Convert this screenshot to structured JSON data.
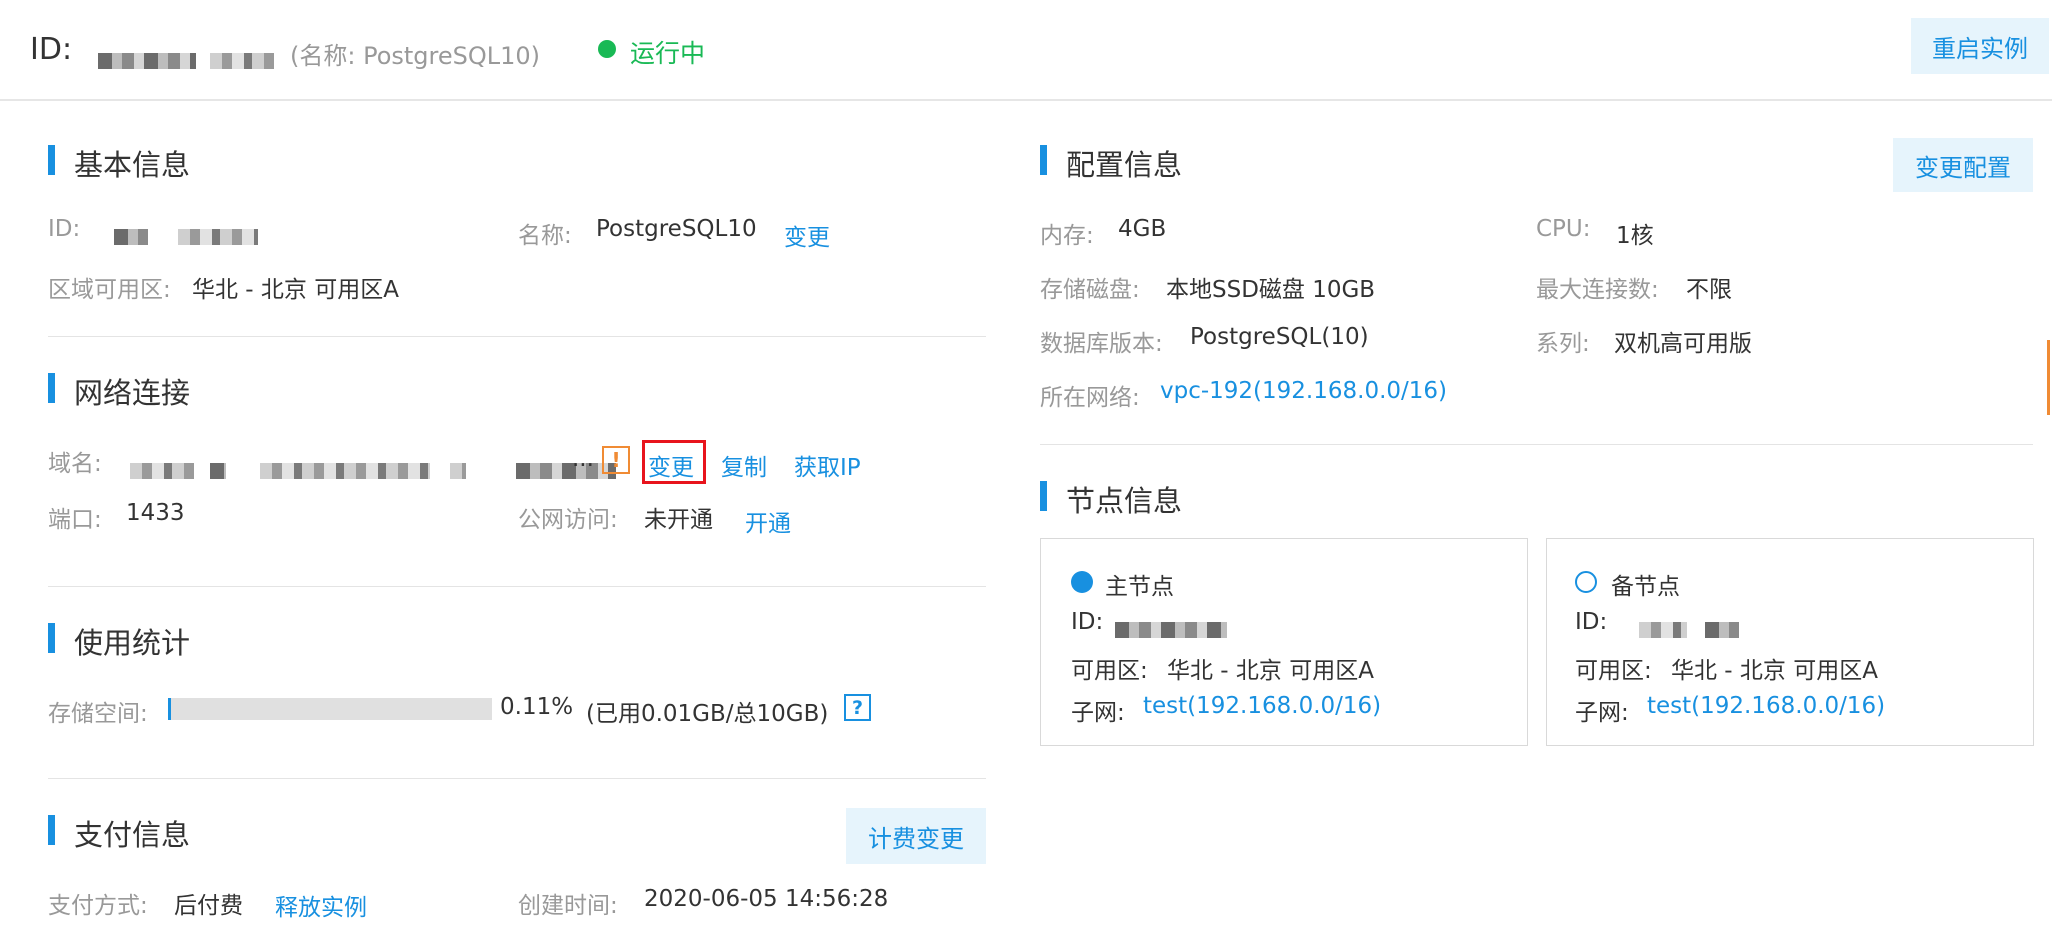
{
  "header": {
    "id_label": "ID:",
    "name_hint": "(名称: PostgreSQL10)",
    "status": "运行中",
    "status_color": "#19b955",
    "restart_button": "重启实例"
  },
  "basic": {
    "title": "基本信息",
    "id_label": "ID:",
    "name_label": "名称:",
    "name_value": "PostgreSQL10",
    "name_change": "变更",
    "zone_label": "区域可用区:",
    "zone_value": "华北 - 北京 可用区A"
  },
  "network": {
    "title": "网络连接",
    "domain_label": "域名:",
    "domain_ellipsis": "...",
    "warn_icon": "!",
    "change": "变更",
    "copy": "复制",
    "get_ip": "获取IP",
    "port_label": "端口:",
    "port_value": "1433",
    "public_label": "公网访问:",
    "public_value": "未开通",
    "public_open": "开通"
  },
  "usage": {
    "title": "使用统计",
    "storage_label": "存储空间:",
    "percent_text": "0.11%",
    "percent": 0.11,
    "detail": "(已用0.01GB/总10GB)",
    "help_icon": "?"
  },
  "payment": {
    "title": "支付信息",
    "billing_change_button": "计费变更",
    "method_label": "支付方式:",
    "method_value": "后付费",
    "release": "释放实例",
    "created_label": "创建时间:",
    "created_value": "2020-06-05 14:56:28"
  },
  "config": {
    "title": "配置信息",
    "change_button": "变更配置",
    "memory_label": "内存:",
    "memory_value": "4GB",
    "cpu_label": "CPU:",
    "cpu_value": "1核",
    "disk_label": "存储磁盘:",
    "disk_value": "本地SSD磁盘 10GB",
    "maxconn_label": "最大连接数:",
    "maxconn_value": "不限",
    "dbver_label": "数据库版本:",
    "dbver_value": "PostgreSQL(10)",
    "series_label": "系列:",
    "series_value": "双机高可用版",
    "network_label": "所在网络:",
    "network_value": "vpc-192(192.168.0.0/16)"
  },
  "nodes": {
    "title": "节点信息",
    "primary": {
      "name": "主节点",
      "id_label": "ID:",
      "zone_label": "可用区:",
      "zone_value": "华北 - 北京 可用区A",
      "subnet_label": "子网:",
      "subnet_value": "test(192.168.0.0/16)"
    },
    "standby": {
      "name": "备节点",
      "id_label": "ID:",
      "zone_label": "可用区:",
      "zone_value": "华北 - 北京 可用区A",
      "subnet_label": "子网:",
      "subnet_value": "test(192.168.0.0/16)"
    }
  },
  "colors": {
    "accent": "#1890e0",
    "warning": "#f08b34",
    "highlight": "#e8141d"
  }
}
